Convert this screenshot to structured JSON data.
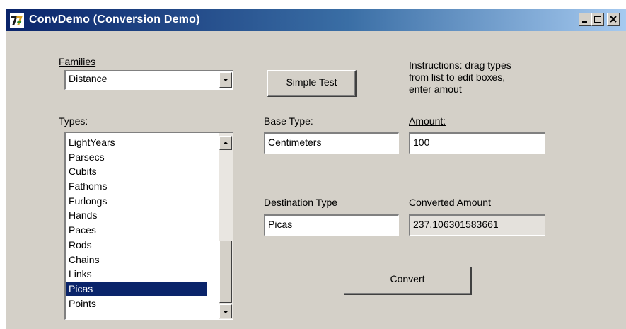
{
  "window": {
    "title": "ConvDemo (Conversion Demo)",
    "controls": [
      "minimize",
      "maximize",
      "close"
    ]
  },
  "families": {
    "label": "Families",
    "selected": "Distance"
  },
  "simple_test": {
    "label": "Simple Test"
  },
  "instructions": {
    "lines": [
      "Instructions: drag types",
      "from list to edit boxes,",
      "enter amout"
    ]
  },
  "types": {
    "label": "Types:",
    "items": [
      "LightYears",
      "Parsecs",
      "Cubits",
      "Fathoms",
      "Furlongs",
      "Hands",
      "Paces",
      "Rods",
      "Chains",
      "Links",
      "Picas",
      "Points"
    ],
    "selected": "Picas"
  },
  "base_type": {
    "label": "Base Type:",
    "value": "Centimeters"
  },
  "amount": {
    "label": "Amount:",
    "value": "100"
  },
  "destination_type": {
    "label": "Destination Type",
    "value": "Picas"
  },
  "converted_amount": {
    "label": "Converted Amount",
    "value": "237,106301583661"
  },
  "convert": {
    "label": "Convert"
  },
  "colors": {
    "title_bar_start": "#0a246a",
    "title_bar_end": "#a6caf0",
    "selection": "#0a246a",
    "window_face": "#d4d0c8"
  }
}
